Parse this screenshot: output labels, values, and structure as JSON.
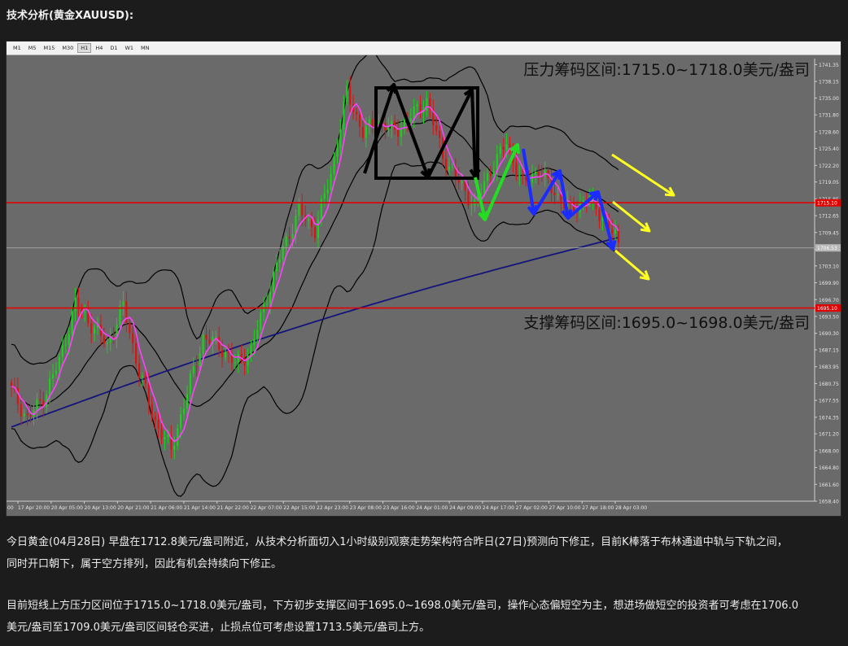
{
  "header": {
    "title": "技术分析(黄金XAUUSD):"
  },
  "toolbar": {
    "timeframes": [
      "M1",
      "M5",
      "M15",
      "M30",
      "H1",
      "H4",
      "D1",
      "W1",
      "MN"
    ],
    "active": "H1"
  },
  "chart_data": {
    "type": "candlestick",
    "instrument": "XAUUSD",
    "timeframe": "H1",
    "ylim": [
      1658.4,
      1742.5
    ],
    "y_ticks": [
      1741.35,
      1738.15,
      1735.0,
      1731.8,
      1728.6,
      1725.4,
      1722.2,
      1719.05,
      1715.85,
      1712.65,
      1709.45,
      1706.25,
      1703.1,
      1699.9,
      1696.7,
      1693.5,
      1690.3,
      1687.15,
      1683.95,
      1680.75,
      1677.55,
      1674.35,
      1671.2,
      1668.0,
      1664.8,
      1661.6,
      1658.4
    ],
    "y_tick_labels": [
      "1741.35",
      "1738.15",
      "1735.00",
      "1731.80",
      "1728.60",
      "1725.40",
      "1722.20",
      "1719.05",
      "1715.85",
      "1712.65",
      "1709.45",
      "1706.25",
      "1703.10",
      "1699.90",
      "1696.70",
      "1693.50",
      "1690.30",
      "1687.15",
      "1683.95",
      "1680.75",
      "1677.55",
      "1674.35",
      "1671.20",
      "1668.00",
      "1664.80",
      "1661.60",
      "1658.40"
    ],
    "x_labels": [
      "17 Apr 20:00",
      "20 Apr 05:00",
      "20 Apr 13:00",
      "20 Apr 21:00",
      "21 Apr 06:00",
      "21 Apr 14:00",
      "21 Apr 22:00",
      "22 Apr 07:00",
      "22 Apr 15:00",
      "22 Apr 23:00",
      "23 Apr 08:00",
      "23 Apr 16:00",
      "24 Apr 01:00",
      "24 Apr 09:00",
      "24 Apr 17:00",
      "27 Apr 02:00",
      "27 Apr 10:00",
      "27 Apr 18:00",
      "28 Apr 03:00"
    ],
    "x_label_edge": "00",
    "price_tags": [
      {
        "value": 1715.1,
        "label": "1715.10",
        "color": "#e00000"
      },
      {
        "value": 1706.53,
        "label": "1706.53",
        "color": "#b8b8b8"
      },
      {
        "value": 1695.1,
        "label": "1695.10",
        "color": "#e00000"
      }
    ],
    "annotations": {
      "resistance": "压力筹码区间:1715.0~1718.0美元/盎司",
      "support": "支撑筹码区间:1695.0~1698.0美元/盎司"
    },
    "resistance_line": 1715.1,
    "support_line": 1695.1,
    "current_price": 1706.53,
    "key_points": [
      1679.5,
      1674.0,
      1678.0,
      1685.0,
      1696.0,
      1692.0,
      1688.0,
      1695.5,
      1683.0,
      1673.5,
      1668.0,
      1679.0,
      1689.5,
      1688.0,
      1684.5,
      1687.0,
      1697.5,
      1706.5,
      1713.5,
      1710.0,
      1720.5,
      1736.0,
      1728.5,
      1730.5,
      1728.5,
      1731.5,
      1734.5,
      1724.0,
      1719.0,
      1714.5,
      1721.5,
      1726.5,
      1718.5,
      1721.5,
      1717.0,
      1713.5,
      1716.0,
      1712.5,
      1707.5
    ],
    "colors": {
      "background": "#6a6a6a",
      "up": "#18d418",
      "down": "#e01010",
      "ma_fast": "#ff40ff",
      "ma_slow": "#14147a",
      "bands": "#000000",
      "levels": "#e00000"
    }
  },
  "article": {
    "paragraph1_line1": "今日黄金(04月28日) 早盘在1712.8美元/盎司附近，从技术分析面切入1小时级别观察走势架构符合昨日(27日)预测向下修正，目前K棒落于布林通道中轨与下轨之间，",
    "paragraph1_line2": "同时开口朝下，属于空方排列，因此有机会持续向下修正。",
    "paragraph2_line1": "目前短线上方压力区间位于1715.0~1718.0美元/盎司，下方初步支撑区间于1695.0~1698.0美元/盎司，操作心态偏短空为主，想进场做短空的投资者可考虑在1706.0",
    "paragraph2_line2": "美元/盎司至1709.0美元/盎司区间轻仓买进，止损点位可考虑设置1713.5美元/盎司上方。"
  }
}
